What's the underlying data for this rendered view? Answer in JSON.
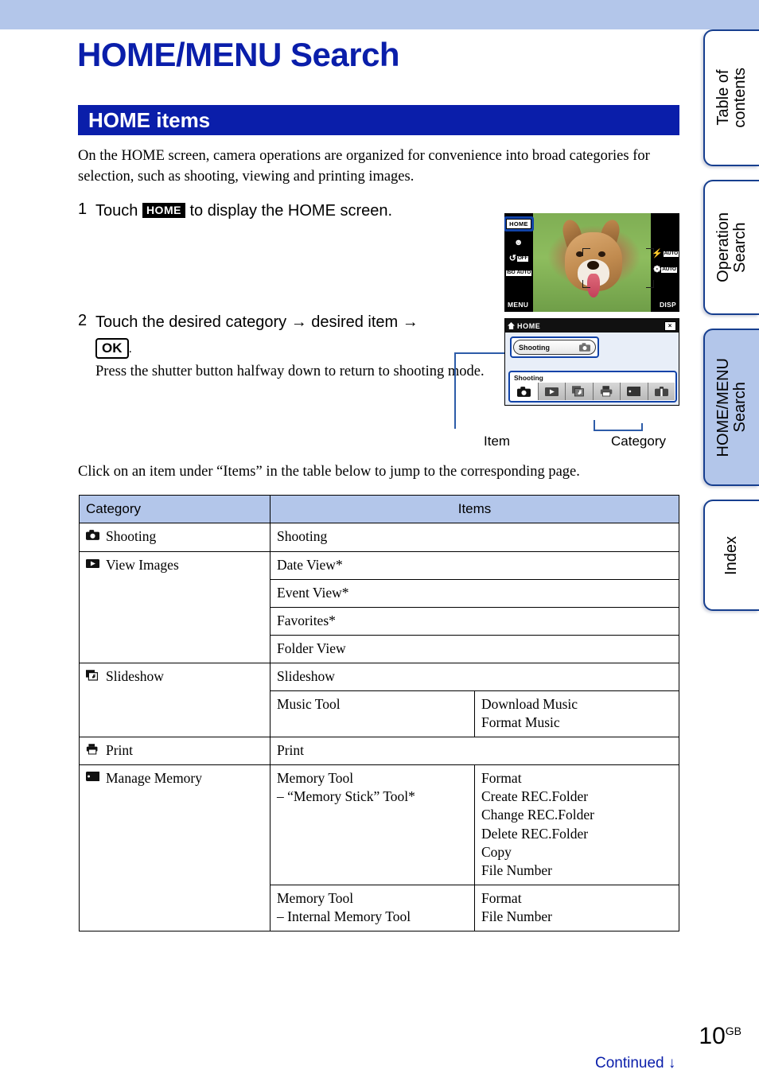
{
  "document": {
    "title": "HOME/MENU Search",
    "section_heading": "HOME items",
    "intro": "On the HOME screen, camera operations are organized for convenience into broad categories for selection, such as shooting, viewing and printing images.",
    "click_note": "Click on an item under “Items” in the table below to jump to the corresponding page."
  },
  "sidebar": {
    "tabs": [
      {
        "label": "Table of\ncontents",
        "active": false
      },
      {
        "label": "Operation\nSearch",
        "active": false
      },
      {
        "label": "HOME/MENU\nSearch",
        "active": true
      },
      {
        "label": "Index",
        "active": false
      }
    ]
  },
  "steps": [
    {
      "number": "1",
      "text_before": "Touch",
      "badge": "HOME",
      "text_after": "to display the HOME screen."
    },
    {
      "number": "2",
      "line1": "Touch the desired category → desired item →",
      "badge": "OK",
      "punctuation": ".",
      "note": "Press the shutter button halfway down to return to shooting mode."
    }
  ],
  "illustration": {
    "shooting_screen": {
      "home_button": "HOME",
      "left_icons": [
        {
          "name": "smile-shutter-icon",
          "glyph": "☻",
          "tag": ""
        },
        {
          "name": "self-timer-icon",
          "glyph": "↺",
          "tag": "OFF"
        },
        {
          "name": "iso-icon",
          "glyph": "ISO",
          "tag": "AUTO"
        }
      ],
      "menu_label": "MENU",
      "right_icons": [
        {
          "name": "flash-icon",
          "glyph": "⚡",
          "tag": "AUTO"
        },
        {
          "name": "macro-icon",
          "glyph": "❁",
          "tag": "AUTO"
        }
      ],
      "disp_label": "DISP"
    },
    "home_screen": {
      "title": "HOME",
      "close_label": "×",
      "item_label": "Shooting",
      "category_label": "Shooting",
      "category_icons": [
        "shooting-icon",
        "view-images-icon",
        "slideshow-icon",
        "print-icon",
        "manage-memory-icon",
        "settings-icon"
      ]
    },
    "captions": {
      "item": "Item",
      "category": "Category"
    }
  },
  "table": {
    "headers": {
      "category": "Category",
      "items": "Items"
    },
    "rows": [
      {
        "category": "Shooting",
        "category_icon": "shooting-icon",
        "category_rowspan": 1,
        "entries": [
          {
            "item": "Shooting",
            "detail": null,
            "span": 2
          }
        ]
      },
      {
        "category": "View Images",
        "category_icon": "view-images-icon",
        "category_rowspan": 4,
        "entries": [
          {
            "item": "Date View*",
            "detail": null,
            "span": 2
          },
          {
            "item": "Event View*",
            "detail": null,
            "span": 2
          },
          {
            "item": "Favorites*",
            "detail": null,
            "span": 2
          },
          {
            "item": "Folder View",
            "detail": null,
            "span": 2
          }
        ]
      },
      {
        "category": "Slideshow",
        "category_icon": "slideshow-icon",
        "category_rowspan": 2,
        "entries": [
          {
            "item": "Slideshow",
            "detail": null,
            "span": 2
          },
          {
            "item": "Music Tool",
            "detail": "Download Music\nFormat Music",
            "span": 1
          }
        ]
      },
      {
        "category": "Print",
        "category_icon": "print-icon",
        "category_rowspan": 1,
        "entries": [
          {
            "item": "Print",
            "detail": null,
            "span": 2
          }
        ]
      },
      {
        "category": "Manage Memory",
        "category_icon": "manage-memory-icon",
        "category_rowspan": 2,
        "entries": [
          {
            "item": "Memory Tool\n– “Memory Stick” Tool*",
            "detail": "Format\nCreate REC.Folder\nChange REC.Folder\nDelete REC.Folder\nCopy\nFile Number",
            "span": 1
          },
          {
            "item": "Memory Tool\n– Internal Memory Tool",
            "detail": "Format\nFile Number",
            "span": 1
          }
        ]
      }
    ]
  },
  "footer": {
    "page_number": "10",
    "page_suffix": "GB",
    "continued": "Continued ↓"
  },
  "colors": {
    "band": "#b3c6ea",
    "heading_blue": "#0a1eaa",
    "tab_border": "#173f8f",
    "leader": "#2d5ca8"
  }
}
